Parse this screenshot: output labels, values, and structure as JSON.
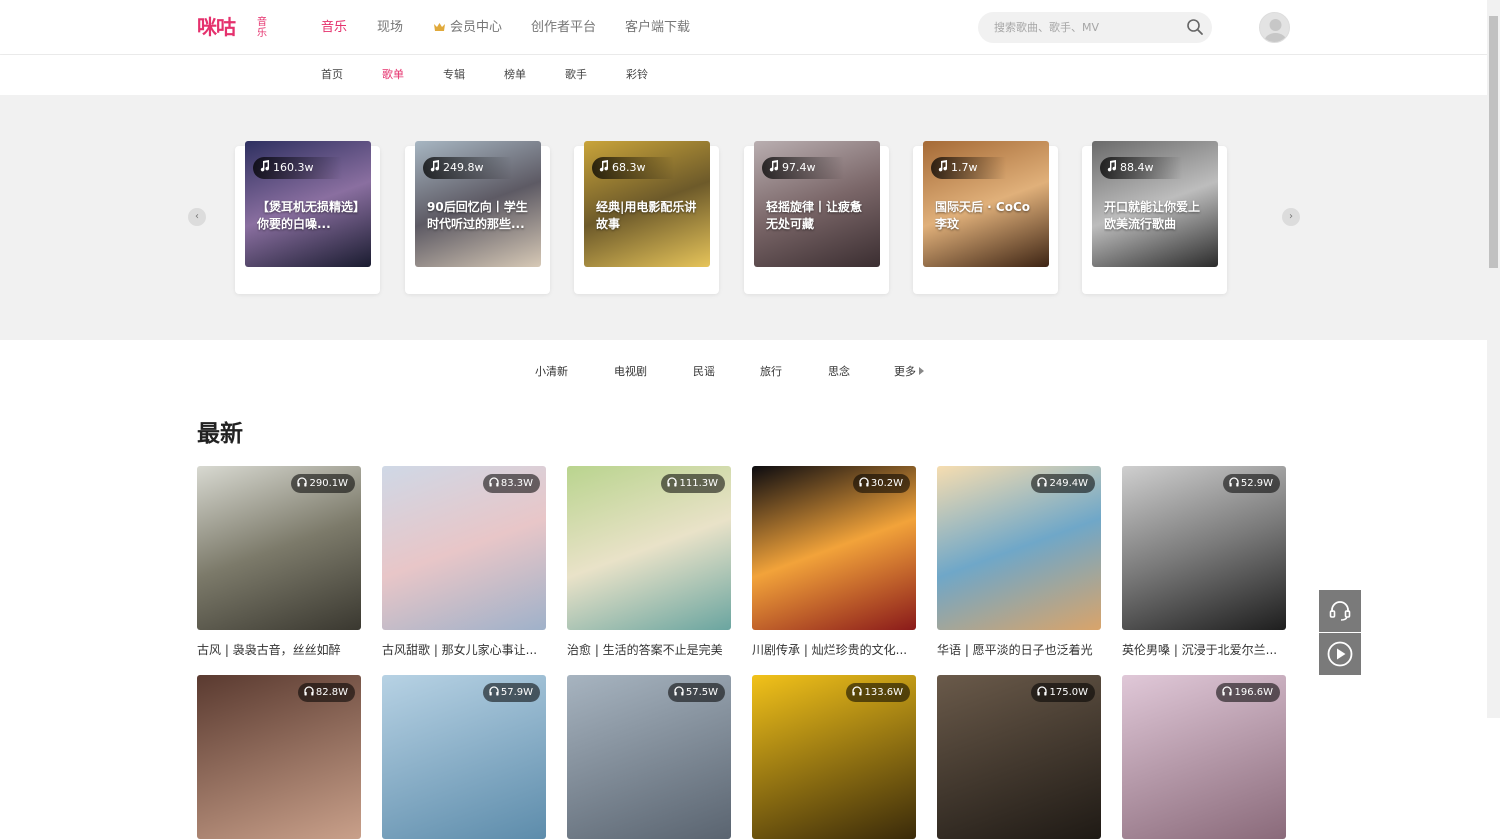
{
  "brand": {
    "logo_text": "咪咕",
    "logo_sub": "音乐",
    "color": "#e5316d"
  },
  "header": {
    "nav": [
      {
        "label": "音乐",
        "active": true
      },
      {
        "label": "现场",
        "active": false
      },
      {
        "label": "会员中心",
        "active": false,
        "icon": "crown-icon"
      },
      {
        "label": "创作者平台",
        "active": false
      },
      {
        "label": "客户端下载",
        "active": false
      }
    ],
    "search": {
      "placeholder": "搜索歌曲、歌手、MV"
    }
  },
  "subnav": [
    {
      "label": "首页",
      "active": false
    },
    {
      "label": "歌单",
      "active": true
    },
    {
      "label": "专辑",
      "active": false
    },
    {
      "label": "榜单",
      "active": false
    },
    {
      "label": "歌手",
      "active": false
    },
    {
      "label": "彩铃",
      "active": false
    }
  ],
  "banner": {
    "cards": [
      {
        "count": "160.3w",
        "title": "【煲耳机无损精选】你要的白噪...",
        "colors": [
          "#2e3060",
          "#8a6fa0",
          "#1a1c30"
        ]
      },
      {
        "count": "249.8w",
        "title": "90后回忆向丨学生时代听过的那些...",
        "colors": [
          "#a7b6c2",
          "#5d5a64",
          "#d7c9b6"
        ]
      },
      {
        "count": "68.3w",
        "title": "经典|用电影配乐讲故事",
        "colors": [
          "#c9a43a",
          "#6d5a2a",
          "#e6c45a"
        ]
      },
      {
        "count": "97.4w",
        "title": "轻摇旋律丨让疲惫无处可藏",
        "colors": [
          "#b9aeb0",
          "#7a6668",
          "#3b2e31"
        ]
      },
      {
        "count": "1.7w",
        "title": "国际天后 · CoCo李玟",
        "colors": [
          "#a56a36",
          "#e0b07a",
          "#3d2414"
        ]
      },
      {
        "count": "88.4w",
        "title": "开口就能让你爱上欧美流行歌曲",
        "colors": [
          "#6a6a6a",
          "#bdbdbd",
          "#2b2b2b"
        ]
      }
    ]
  },
  "categories": [
    {
      "label": "小清新"
    },
    {
      "label": "电视剧"
    },
    {
      "label": "民谣"
    },
    {
      "label": "旅行"
    },
    {
      "label": "思念"
    },
    {
      "label": "更多"
    }
  ],
  "section": {
    "title": "最新"
  },
  "playlists_row1": [
    {
      "count": "290.1W",
      "title": "古风 | 袅袅古音，丝丝如醉",
      "colors": [
        "#d8d9d1",
        "#7c7a6a",
        "#3a3830"
      ]
    },
    {
      "count": "83.3W",
      "title": "古风甜歌 | 那女儿家心事让...",
      "colors": [
        "#cfd8e6",
        "#e8c6c8",
        "#9fb1c9"
      ]
    },
    {
      "count": "111.3W",
      "title": "治愈 | 生活的答案不止是完美",
      "colors": [
        "#b9d48e",
        "#e9e2c8",
        "#6aa5a0"
      ]
    },
    {
      "count": "30.2W",
      "title": "川剧传承 | 灿烂珍贵的文化...",
      "colors": [
        "#0c0b10",
        "#f2a33a",
        "#8a1a1a"
      ]
    },
    {
      "count": "249.4W",
      "title": "华语 | 愿平淡的日子也泛着光",
      "colors": [
        "#f6ddb0",
        "#6fa7c8",
        "#d9a46a"
      ]
    },
    {
      "count": "52.9W",
      "title": "英伦男嗓 | 沉浸于北爱尔兰...",
      "colors": [
        "#cfcfcf",
        "#7a7a7a",
        "#1e1e1e"
      ]
    }
  ],
  "playlists_row2": [
    {
      "count": "82.8W",
      "colors": [
        "#5a3a30",
        "#c9a08a"
      ]
    },
    {
      "count": "57.9W",
      "colors": [
        "#b7d2e4",
        "#5d8cab"
      ]
    },
    {
      "count": "57.5W",
      "colors": [
        "#a7b4c0",
        "#5a6470"
      ]
    },
    {
      "count": "133.6W",
      "colors": [
        "#f2c21a",
        "#3a2a0a"
      ]
    },
    {
      "count": "175.0W",
      "colors": [
        "#6a5a4a",
        "#1f1a15"
      ]
    },
    {
      "count": "196.6W",
      "colors": [
        "#e0c8d8",
        "#8a6a7a"
      ]
    }
  ],
  "floating": {
    "service_icon": "headset-icon",
    "player_icon": "play-circle-icon"
  }
}
